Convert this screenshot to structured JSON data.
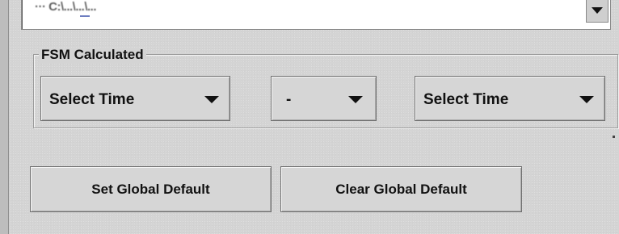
{
  "top_field": {
    "value": "··· C:\\...\\...\\...",
    "dropdown_icon": "chevron-down-icon"
  },
  "fsm_group": {
    "title": "FSM Calculated",
    "start_combo": {
      "value": "Select Time"
    },
    "operator_combo": {
      "value": "-"
    },
    "end_combo": {
      "value": "Select Time"
    },
    "dropdown_icon": "triangle-down-icon"
  },
  "buttons": {
    "set_global_default": "Set Global Default",
    "clear_global_default": "Clear Global Default"
  }
}
